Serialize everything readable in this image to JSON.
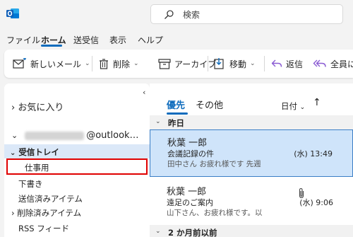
{
  "app": {
    "logo": "outlook-logo",
    "accent": "#0f6cbd"
  },
  "search": {
    "placeholder": "検索"
  },
  "menu": {
    "items": [
      "ファイル",
      "ホーム",
      "送受信",
      "表示",
      "ヘルプ"
    ],
    "active": "ホーム"
  },
  "ribbon": {
    "new_mail": "新しいメール",
    "delete": "削除",
    "archive": "アーカイブ",
    "move": "移動",
    "reply": "返信",
    "reply_all": "全員に"
  },
  "folders": {
    "favorites": "お気に入り",
    "account_suffix": "@outlook…",
    "inbox": "受信トレイ",
    "highlighted_folder": "仕事用",
    "drafts": "下書き",
    "sent": "送信済みアイテム",
    "deleted": "削除済みアイテム",
    "rss": "RSS フィード"
  },
  "list": {
    "tabs": {
      "focused": "優先",
      "other": "その他"
    },
    "sort": "日付",
    "groups": {
      "yesterday": "昨日",
      "two_months": "2 か月前以前"
    },
    "messages": [
      {
        "from": "秋葉 一郎",
        "subject": "会議記録の件",
        "time": "(水) 13:49",
        "preview": "田中さん お疲れ様です 先週",
        "selected": true,
        "attachment": false
      },
      {
        "from": "秋葉 一郎",
        "subject": "遠足のご案内",
        "time": "(水) 9:06",
        "preview": "山下さん、お疲れ様です。以",
        "selected": false,
        "attachment": true
      }
    ]
  }
}
